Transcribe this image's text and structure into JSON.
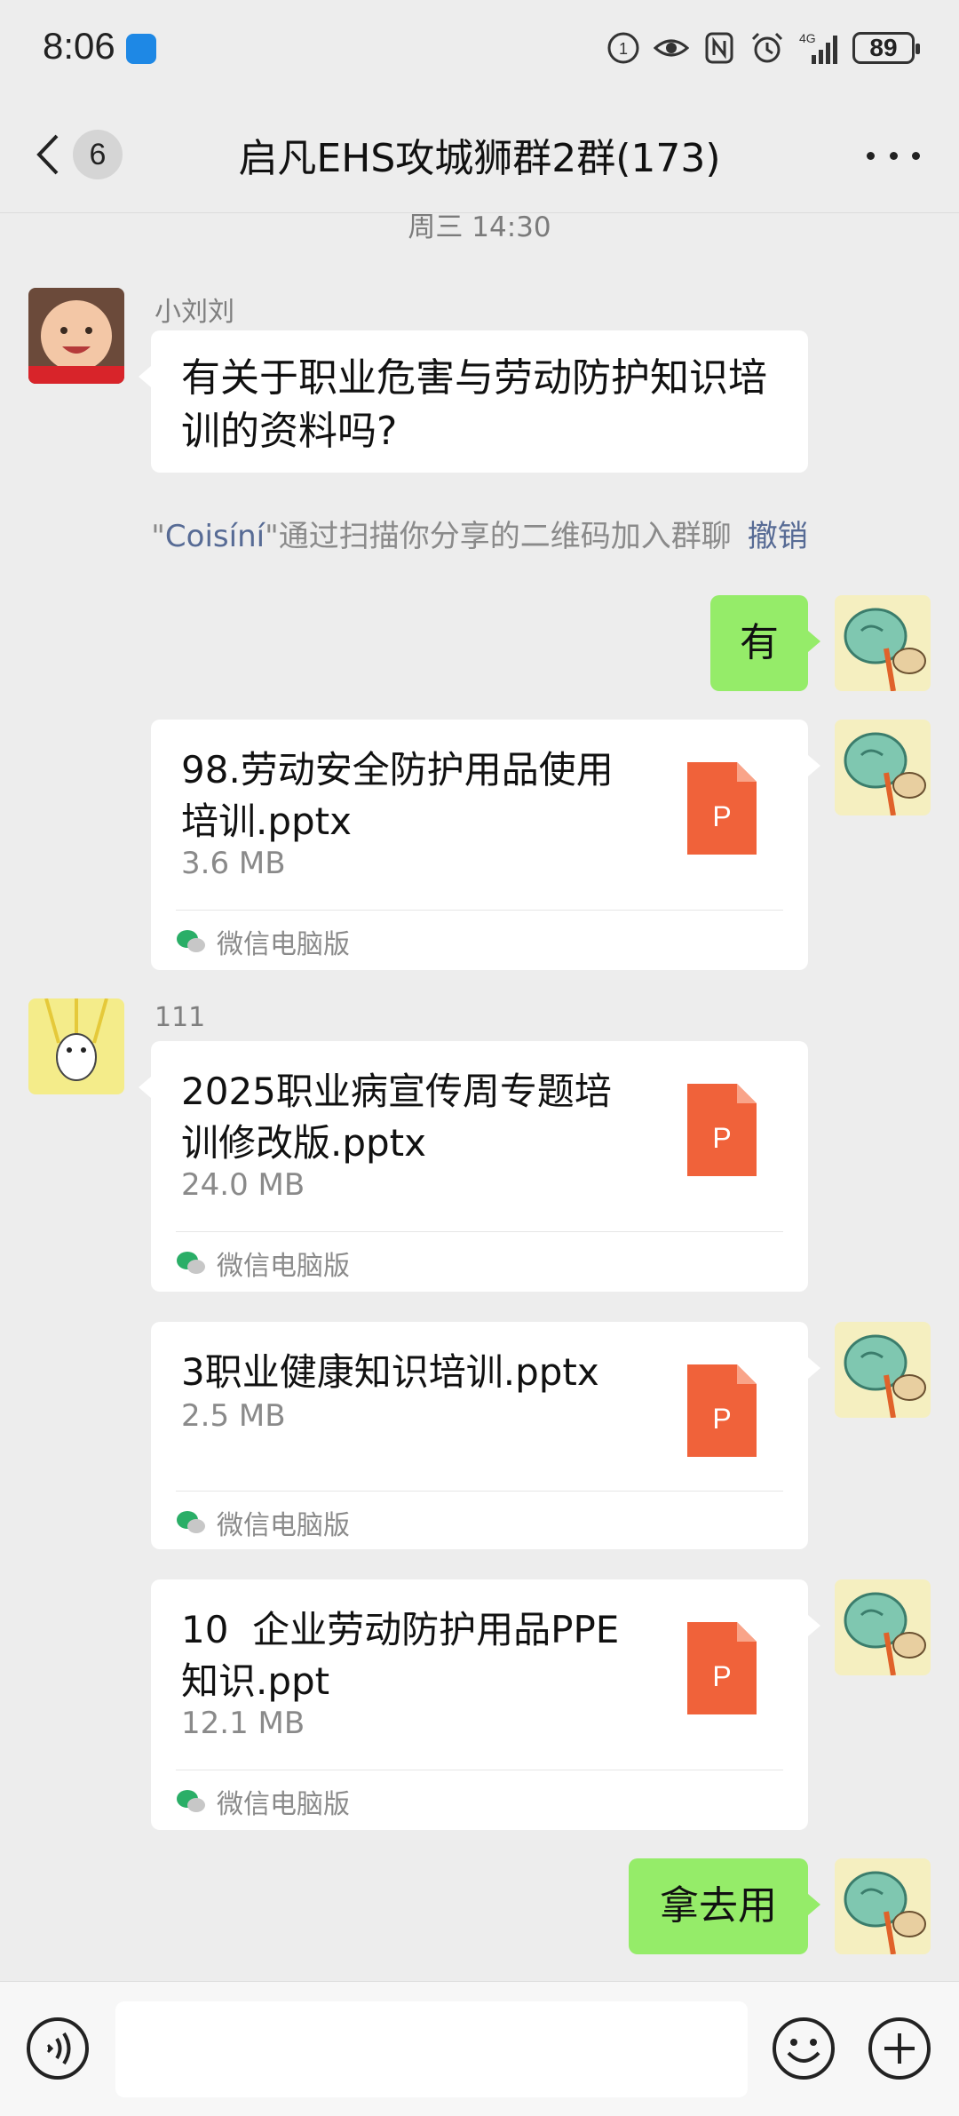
{
  "status_bar": {
    "time": "8:06",
    "network": "4G",
    "battery": "89"
  },
  "header": {
    "back_badge": "6",
    "title": "启凡EHS攻城狮群2群(173)"
  },
  "chat": {
    "timestamp": "周三 14:30",
    "sender1_name": "小刘刘",
    "sender1_text": "有关于职业危害与劳动防护知识培训的资料吗?",
    "system_notice": {
      "quote_open": "\"",
      "who": "Coisíní",
      "rest": "\"通过扫描你分享的二维码加入群聊",
      "revoke": "撤销"
    },
    "reply1": "有",
    "sender2_name": "111",
    "files": [
      {
        "name": "98.劳动安全防护用品使用培训.pptx",
        "size": "3.6 MB",
        "source": "微信电脑版"
      },
      {
        "name": "2025职业病宣传周专题培训修改版.pptx",
        "size": "24.0 MB",
        "source": "微信电脑版"
      },
      {
        "name": "3职业健康知识培训.pptx",
        "size": "2.5 MB",
        "source": "微信电脑版"
      },
      {
        "name": "10  企业劳动防护用品PPE知识.ppt",
        "size": "12.1 MB",
        "source": "微信电脑版"
      }
    ],
    "reply2": "拿去用",
    "ppt_letter": "P"
  },
  "input": {
    "placeholder": ""
  },
  "colors": {
    "green_bubble": "#95ec69",
    "ppt_orange": "#f0623a",
    "link_blue": "#576b95"
  }
}
